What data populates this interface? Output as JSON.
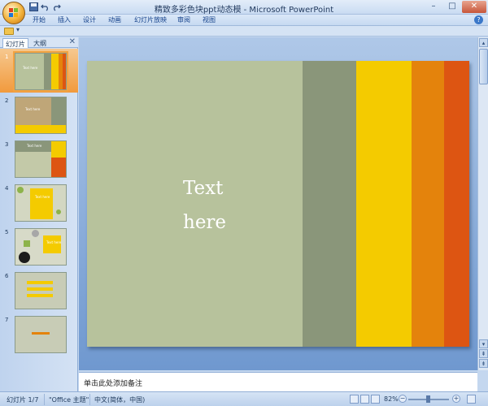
{
  "window": {
    "title": "精致多彩色块ppt动态模 - Microsoft PowerPoint",
    "minimize": "–",
    "maximize": "□",
    "close": "✕"
  },
  "ribbon": {
    "tabs": [
      "开始",
      "插入",
      "设计",
      "动画",
      "幻灯片放映",
      "审阅",
      "视图"
    ],
    "help": "?"
  },
  "panel": {
    "tabs": [
      "幻灯片",
      "大纲"
    ],
    "close": "✕",
    "thumbnails": [
      {
        "number": "1",
        "text": "Text here"
      },
      {
        "number": "2",
        "text": "Text here"
      },
      {
        "number": "3",
        "text": "Text here"
      },
      {
        "number": "4",
        "text": "Text here"
      },
      {
        "number": "5",
        "text": "Text here"
      },
      {
        "number": "6",
        "text": ""
      },
      {
        "number": "7",
        "text": ""
      }
    ]
  },
  "slide": {
    "text_line1": "Text",
    "text_line2": "here",
    "bands": [
      {
        "color": "#b7c29c"
      },
      {
        "color": "#8a967a"
      },
      {
        "color": "#f4cb00"
      },
      {
        "color": "#e4830c"
      },
      {
        "color": "#dd5512"
      }
    ]
  },
  "notes": {
    "placeholder": "单击此处添加备注"
  },
  "status": {
    "slide_counter": "幻灯片 1/7",
    "theme": "\"Office 主题\"",
    "language": "中文(简体，中国)",
    "zoom": "82%",
    "zoom_minus": "−",
    "zoom_plus": "+"
  },
  "colors": {
    "selected_thumb_highlight": "#f19a3d",
    "canvas_background": "#7ea3d4"
  }
}
